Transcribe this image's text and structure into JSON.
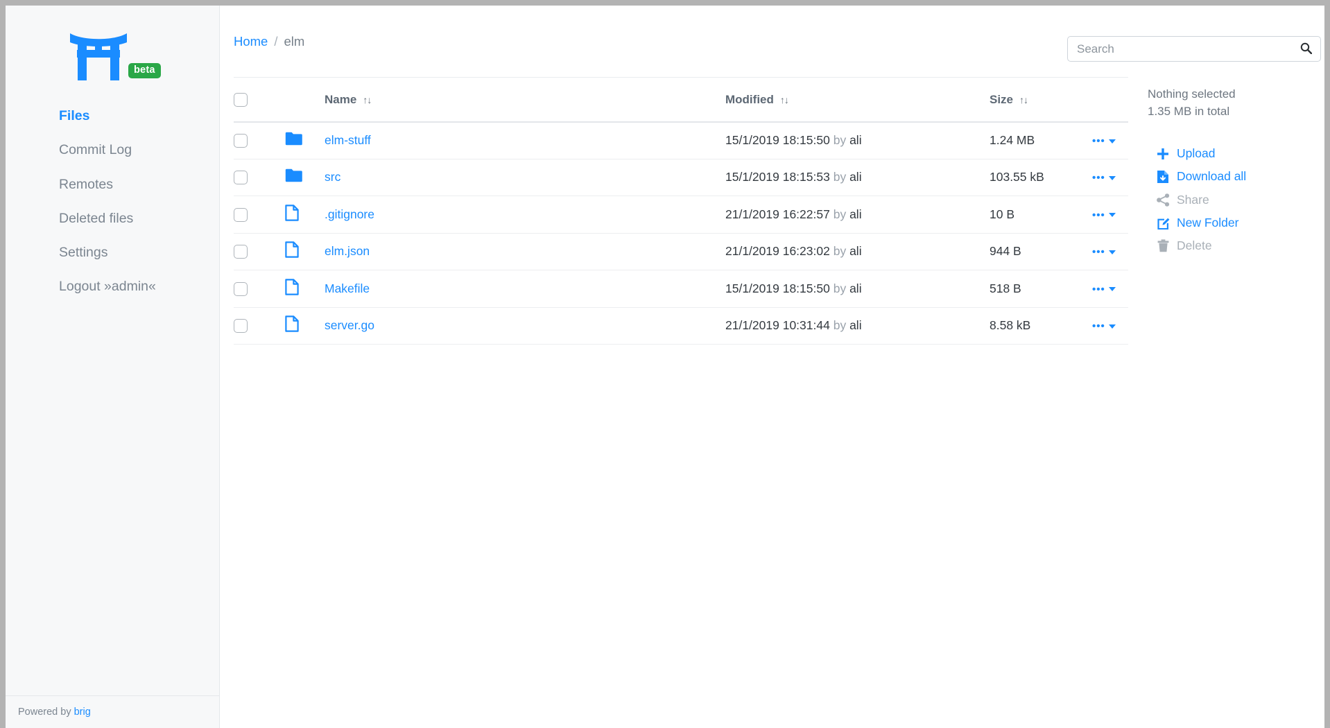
{
  "brand": {
    "logo_icon": "torii-gate-icon",
    "badge": "beta",
    "badge_color": "#2aa747",
    "accent_color": "#1a8cff"
  },
  "sidebar": {
    "items": [
      {
        "label": "Files",
        "active": true
      },
      {
        "label": "Commit Log",
        "active": false
      },
      {
        "label": "Remotes",
        "active": false
      },
      {
        "label": "Deleted files",
        "active": false
      },
      {
        "label": "Settings",
        "active": false
      },
      {
        "label": "Logout »admin«",
        "active": false
      }
    ],
    "footer": {
      "prefix": "Powered by",
      "link": "brig"
    }
  },
  "breadcrumb": {
    "home": "Home",
    "separator": "/",
    "current": "elm"
  },
  "search": {
    "placeholder": "Search",
    "value": "",
    "icon": "search-icon"
  },
  "table": {
    "columns": [
      {
        "key": "name",
        "label": "Name",
        "sort": "↑↓"
      },
      {
        "key": "modified",
        "label": "Modified",
        "sort": "↑↓"
      },
      {
        "key": "size",
        "label": "Size",
        "sort": "↑↓"
      }
    ],
    "rows": [
      {
        "icon": "folder-icon",
        "name": "elm-stuff",
        "date": "15/1/2019 18:15:50",
        "by": "by",
        "user": "ali",
        "size": "1.24 MB"
      },
      {
        "icon": "folder-icon",
        "name": "src",
        "date": "15/1/2019 18:15:53",
        "by": "by",
        "user": "ali",
        "size": "103.55 kB"
      },
      {
        "icon": "file-icon",
        "name": ".gitignore",
        "date": "21/1/2019 16:22:57",
        "by": "by",
        "user": "ali",
        "size": "10 B"
      },
      {
        "icon": "file-icon",
        "name": "elm.json",
        "date": "21/1/2019 16:23:02",
        "by": "by",
        "user": "ali",
        "size": "944 B"
      },
      {
        "icon": "file-icon",
        "name": "Makefile",
        "date": "15/1/2019 18:15:50",
        "by": "by",
        "user": "ali",
        "size": "518 B"
      },
      {
        "icon": "file-icon",
        "name": "server.go",
        "date": "21/1/2019 10:31:44",
        "by": "by",
        "user": "ali",
        "size": "8.58 kB"
      }
    ],
    "row_action_label": "•••"
  },
  "panel": {
    "selection_status": "Nothing selected",
    "total_size": "1.35 MB in total",
    "actions": [
      {
        "label": "Upload",
        "icon": "plus-icon",
        "enabled": true
      },
      {
        "label": "Download all",
        "icon": "file-download-icon",
        "enabled": true
      },
      {
        "label": "Share",
        "icon": "share-nodes-icon",
        "enabled": false
      },
      {
        "label": "New Folder",
        "icon": "pen-to-square-icon",
        "enabled": true
      },
      {
        "label": "Delete",
        "icon": "trash-icon",
        "enabled": false
      }
    ]
  }
}
